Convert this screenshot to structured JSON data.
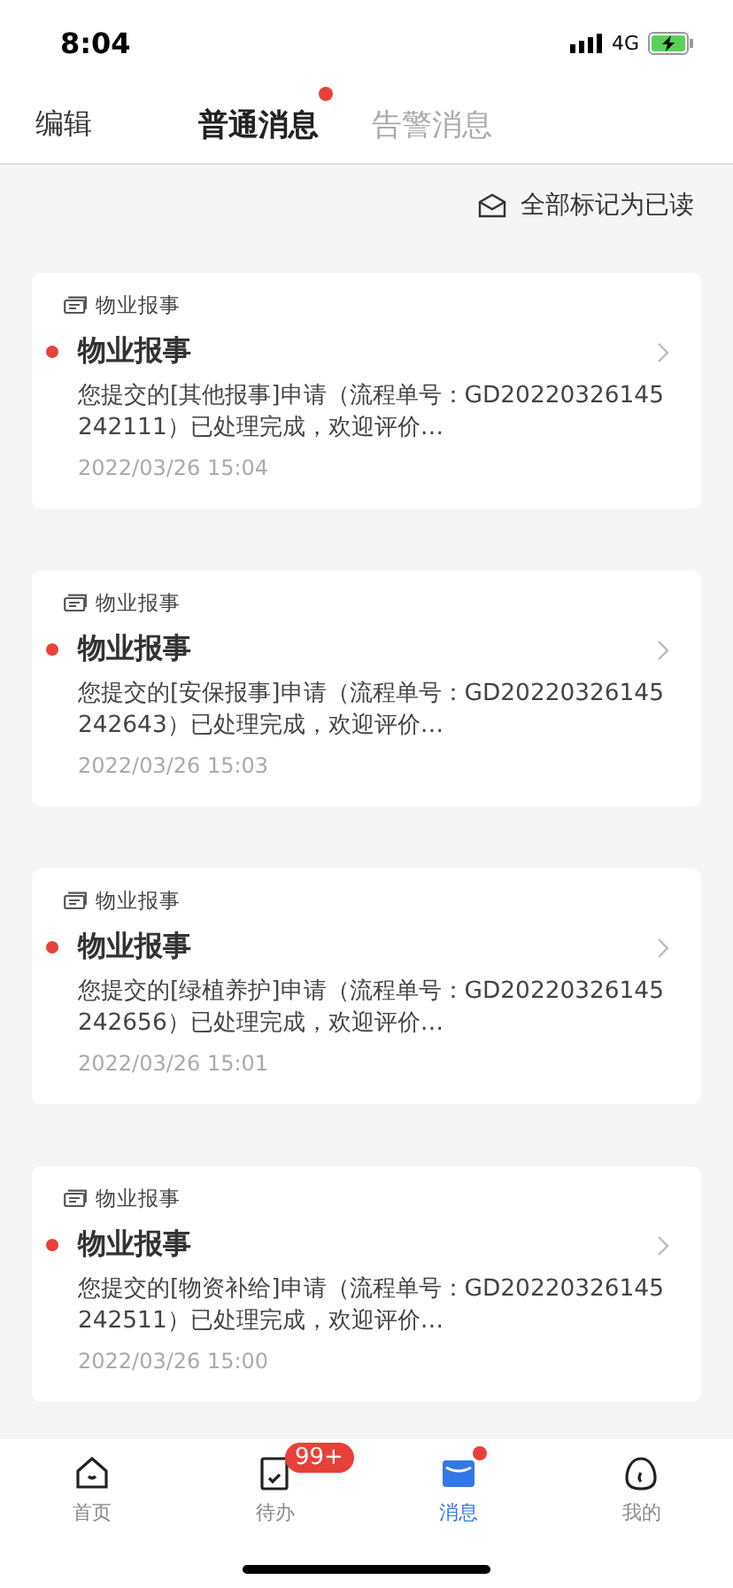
{
  "status_bar": {
    "time": "8:04",
    "network": "4G"
  },
  "header": {
    "edit": "编辑",
    "tabs": [
      {
        "label": "普通消息",
        "selected": true,
        "dot": true
      },
      {
        "label": "告警消息",
        "selected": false,
        "dot": false
      }
    ]
  },
  "mark_all_read": "全部标记为已读",
  "messages": [
    {
      "category": "物业报事",
      "title": "物业报事",
      "unread": true,
      "body": "您提交的[其他报事]申请（流程单号：GD20220326145242111）已处理完成，欢迎评价…",
      "time": "2022/03/26 15:04"
    },
    {
      "category": "物业报事",
      "title": "物业报事",
      "unread": true,
      "body": "您提交的[安保报事]申请（流程单号：GD20220326145242643）已处理完成，欢迎评价…",
      "time": "2022/03/26 15:03"
    },
    {
      "category": "物业报事",
      "title": "物业报事",
      "unread": true,
      "body": "您提交的[绿植养护]申请（流程单号：GD20220326145242656）已处理完成，欢迎评价…",
      "time": "2022/03/26 15:01"
    },
    {
      "category": "物业报事",
      "title": "物业报事",
      "unread": true,
      "body": "您提交的[物资补给]申请（流程单号：GD20220326145242511）已处理完成，欢迎评价…",
      "time": "2022/03/26 15:00"
    }
  ],
  "tab_bar": [
    {
      "label": "首页",
      "selected": false
    },
    {
      "label": "待办",
      "selected": false,
      "badge": "99+"
    },
    {
      "label": "消息",
      "selected": true,
      "dot": true
    },
    {
      "label": "我的",
      "selected": false
    }
  ]
}
